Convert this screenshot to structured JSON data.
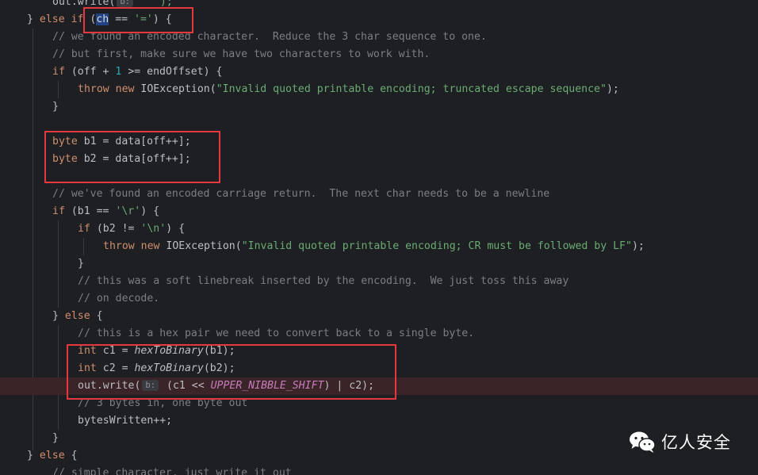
{
  "colors": {
    "background": "#1e1f22",
    "keyword": "#cf8e6d",
    "string": "#6aab73",
    "comment": "#7a7e85",
    "constant": "#c77dbb",
    "highlight_box": "#e5393e",
    "error_line": "#3a2428"
  },
  "hint_label": "b:",
  "code": {
    "l0": {
      "t1": "out.write(",
      "t2": " ' ');"
    },
    "l1": {
      "t1": "} ",
      "t2": "else if",
      "t3": " (",
      "t4": "ch",
      "t5": " == ",
      "t6": "'='",
      "t7": ") {"
    },
    "l2": "// we found an encoded character.  Reduce the 3 char sequence to one.",
    "l3": "// but first, make sure we have two characters to work with.",
    "l4": {
      "t1": "if",
      "t2": " (off + ",
      "t3": "1",
      "t4": " >= endOffset) {"
    },
    "l5": {
      "t1": "throw new",
      "t2": " IOException(",
      "t3": "\"Invalid quoted printable encoding; truncated escape sequence\"",
      "t4": ");"
    },
    "l6": "}",
    "l8": {
      "t1": "byte",
      "t2": " b1 = data[off++];"
    },
    "l9": {
      "t1": "byte",
      "t2": " b2 = data[off++];"
    },
    "l11": "// we've found an encoded carriage return.  The next char needs to be a newline",
    "l12": {
      "t1": "if",
      "t2": " (b1 == ",
      "t3": "'\\r'",
      "t4": ") {"
    },
    "l13": {
      "t1": "if",
      "t2": " (b2 != ",
      "t3": "'\\n'",
      "t4": ") {"
    },
    "l14": {
      "t1": "throw new",
      "t2": " IOException(",
      "t3": "\"Invalid quoted printable encoding; CR must be followed by LF\"",
      "t4": ");"
    },
    "l15": "}",
    "l16": "// this was a soft linebreak inserted by the encoding.  We just toss this away",
    "l17": "// on decode.",
    "l18": {
      "t1": "} ",
      "t2": "else",
      "t3": " {"
    },
    "l19": "// this is a hex pair we need to convert back to a single byte.",
    "l20": {
      "t1": "int",
      "t2": " c1 = ",
      "t3": "hexToBinary",
      "t4": "(b1);"
    },
    "l21": {
      "t1": "int",
      "t2": " c2 = ",
      "t3": "hexToBinary",
      "t4": "(b2);"
    },
    "l22": {
      "t1": "out.write(",
      "t2": " (c1 << ",
      "t3": "UPPER_NIBBLE_SHIFT",
      "t4": ") | c2);"
    },
    "l23": "// 3 bytes in, one byte out",
    "l24": "bytesWritten++;",
    "l25": "}",
    "l26": {
      "t1": "} ",
      "t2": "else",
      "t3": " {"
    },
    "l27": "// simple character, just write it out"
  },
  "watermark": {
    "text": "亿人安全",
    "icon": "wechat-icon"
  }
}
